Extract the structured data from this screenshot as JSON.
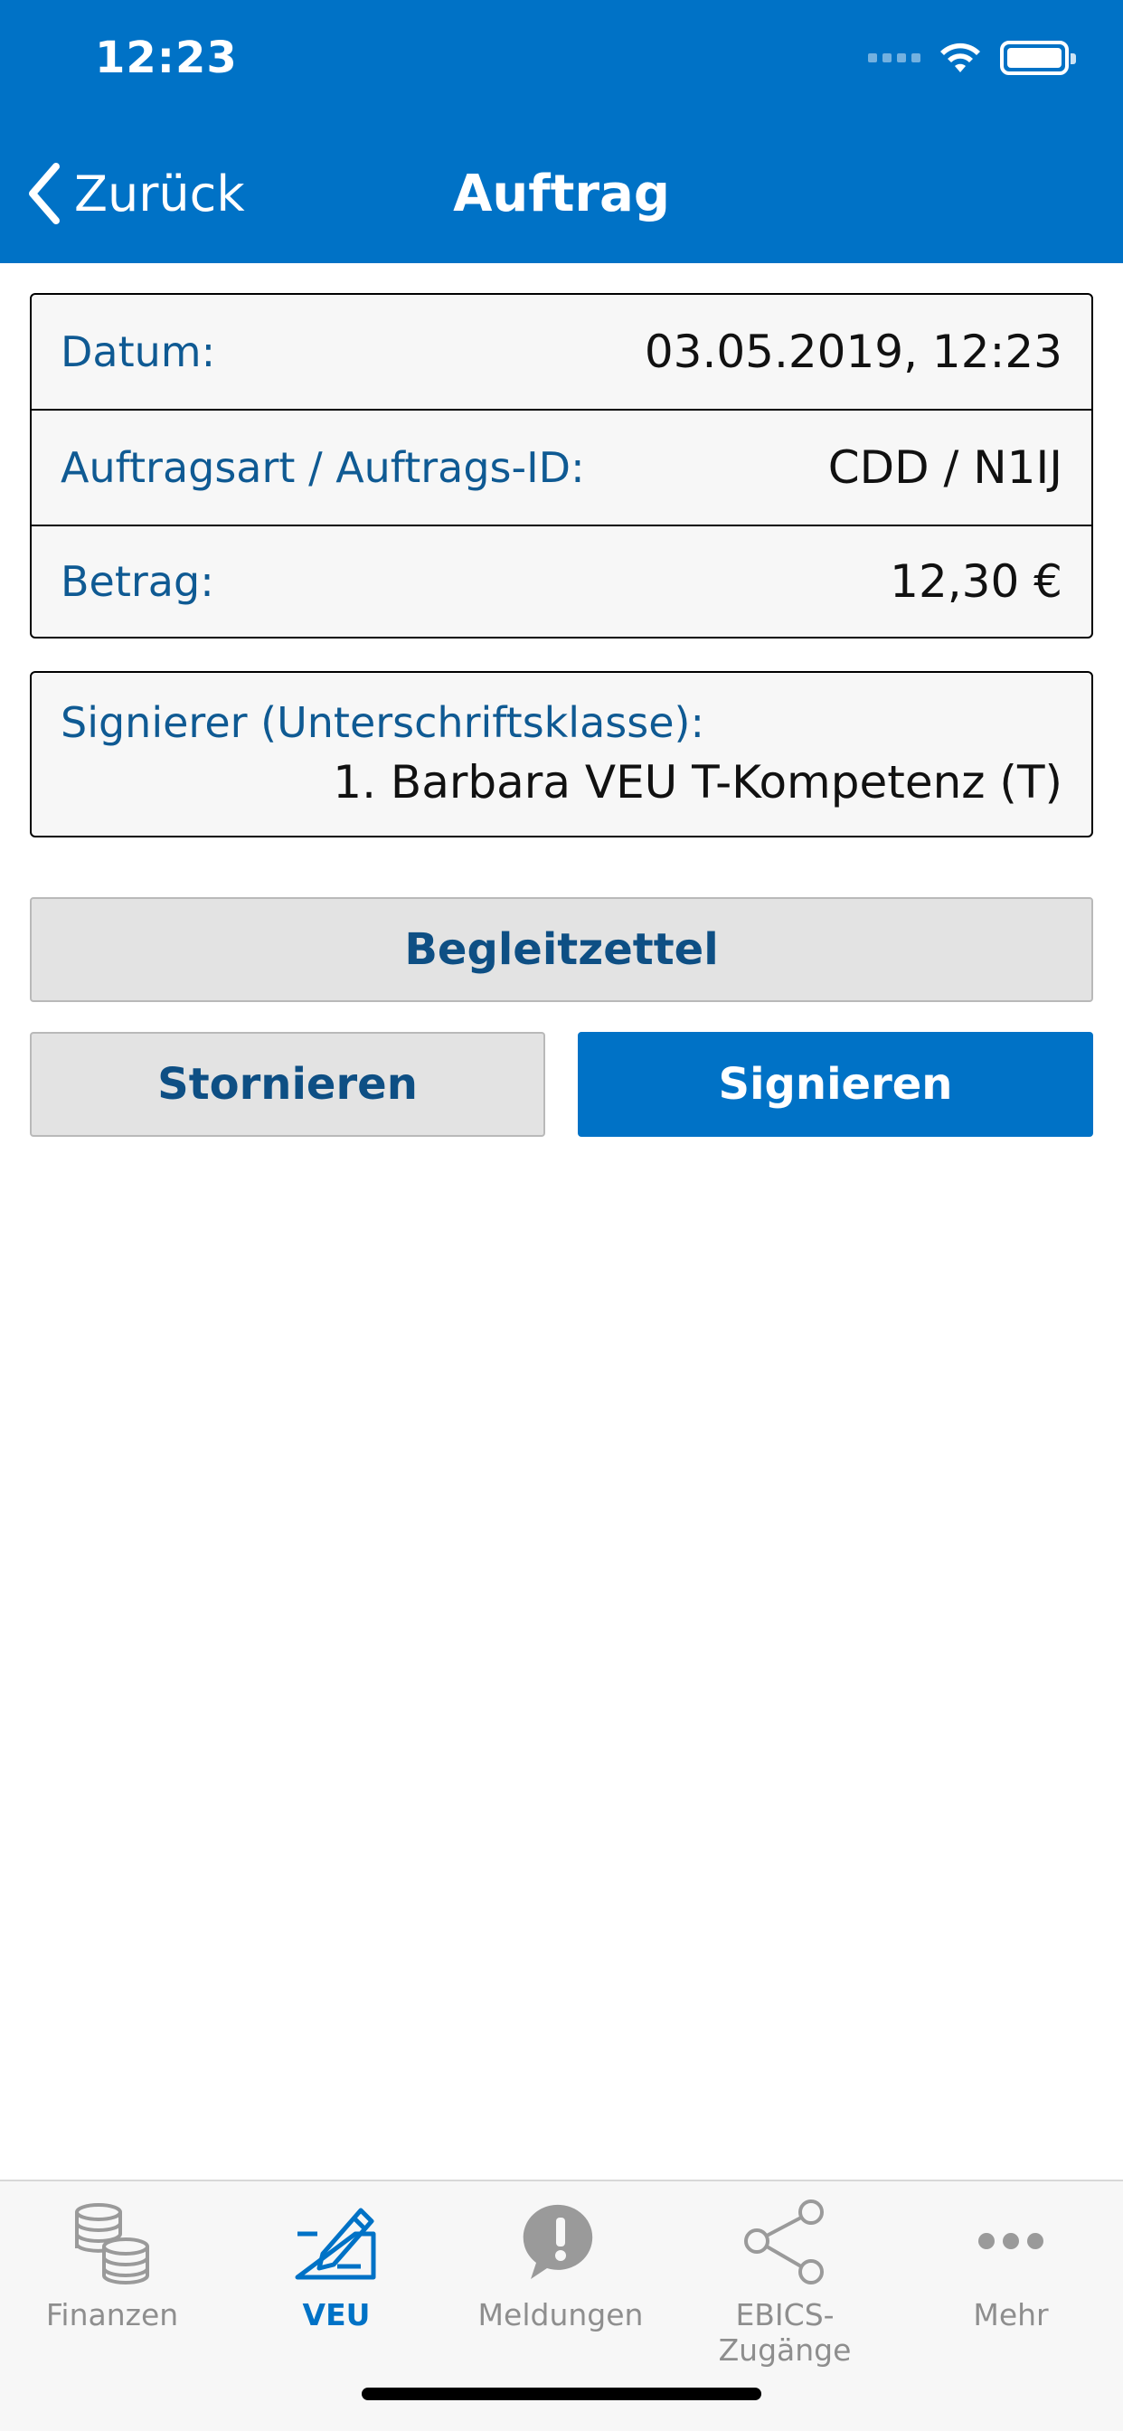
{
  "status_bar": {
    "time": "12:23"
  },
  "nav": {
    "back_label": "Zurück",
    "title": "Auftrag"
  },
  "details": {
    "rows": [
      {
        "label": "Datum:",
        "value": "03.05.2019, 12:23"
      },
      {
        "label": "Auftragsart / Auftrags-ID:",
        "value": "CDD / N1IJ"
      },
      {
        "label": "Betrag:",
        "value": "12,30 €"
      }
    ]
  },
  "signer": {
    "label": "Signierer (Unterschriftsklasse):",
    "value": "1. Barbara VEU T-Kompetenz (T)"
  },
  "actions": {
    "begleitzettel": "Begleitzettel",
    "stornieren": "Stornieren",
    "signieren": "Signieren"
  },
  "tabbar": {
    "items": [
      {
        "label": "Finanzen",
        "icon": "coins-icon",
        "active": false
      },
      {
        "label": "VEU",
        "icon": "sign-pen-icon",
        "active": true
      },
      {
        "label": "Meldungen",
        "icon": "alert-bubble-icon",
        "active": false
      },
      {
        "label": "EBICS-Zugänge",
        "icon": "share-icon",
        "active": false
      },
      {
        "label": "Mehr",
        "icon": "more-icon",
        "active": false
      }
    ]
  },
  "colors": {
    "primary": "#0072c6",
    "label_blue": "#0f5a93",
    "inactive_tab": "#8e8e8e"
  }
}
